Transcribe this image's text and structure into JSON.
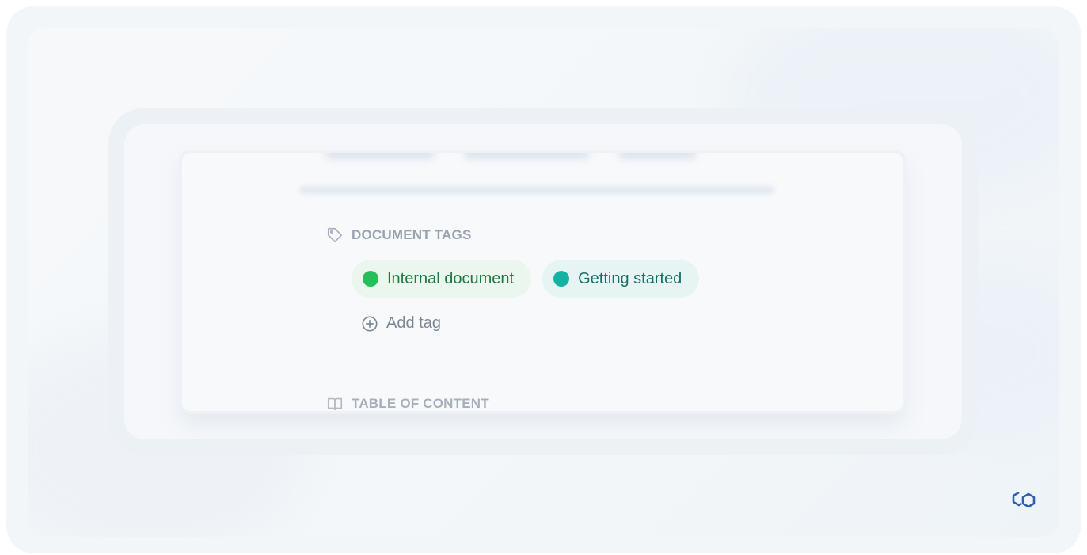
{
  "document_tags": {
    "header": "DOCUMENT TAGS",
    "icon": "tag-icon",
    "tags": [
      {
        "label": "Internal document",
        "dot_color": "#22c05a"
      },
      {
        "label": "Getting started",
        "dot_color": "#14b3a1"
      }
    ],
    "add_tag_label": "Add tag",
    "add_tag_icon": "plus-circle-icon"
  },
  "table_of_content": {
    "header": "TABLE OF CONTENT",
    "icon": "book-icon"
  },
  "brand": {
    "icon": "hexagon-logo-icon",
    "color": "#2f5fb3"
  }
}
